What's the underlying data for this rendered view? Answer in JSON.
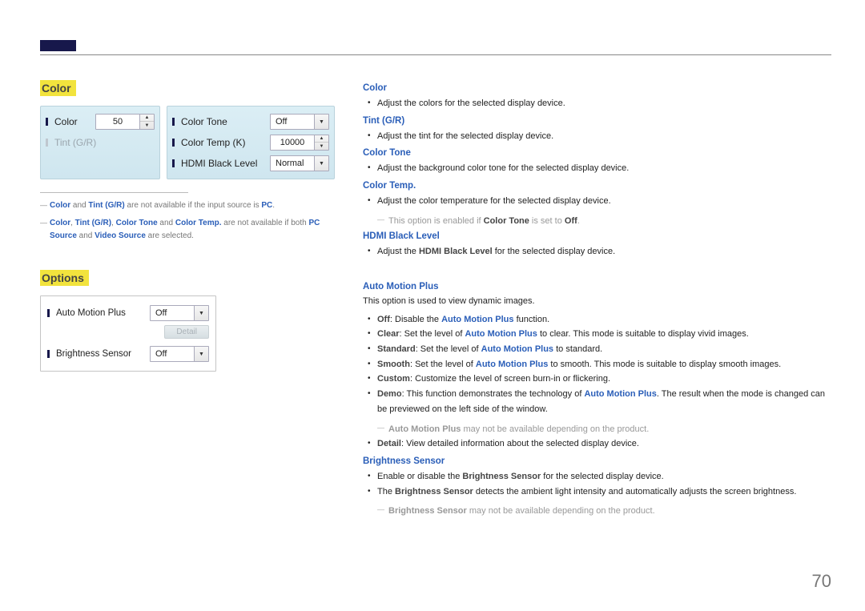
{
  "page_number": "70",
  "sections": {
    "color": {
      "title": "Color"
    },
    "options": {
      "title": "Options"
    }
  },
  "color_panel": {
    "left": {
      "color": {
        "label": "Color",
        "value": "50"
      },
      "tint": {
        "label": "Tint (G/R)"
      }
    },
    "right": {
      "color_tone": {
        "label": "Color Tone",
        "value": "Off"
      },
      "color_temp_k": {
        "label": "Color Temp (K)",
        "value": "10000"
      },
      "hdmi_black": {
        "label": "HDMI Black Level",
        "value": "Normal"
      }
    }
  },
  "color_footnotes": {
    "n1": {
      "b1": "Color",
      "t1": " and ",
      "b2": "Tint (G/R)",
      "t2": " are not available if the input source is ",
      "b3": "PC",
      "t3": "."
    },
    "n2": {
      "b1": "Color",
      "t1": ", ",
      "b2": "Tint (G/R)",
      "t2": ", ",
      "b3": "Color Tone",
      "t3": " and ",
      "b4": "Color Temp.",
      "t4": " are not available if both ",
      "b5": "PC Source",
      "t5": " and ",
      "b6": "Video Source",
      "t6": " are selected."
    }
  },
  "options_panel": {
    "amp": {
      "label": "Auto Motion Plus",
      "value": "Off"
    },
    "detail": {
      "label": "Detail"
    },
    "brightness": {
      "label": "Brightness Sensor",
      "value": "Off"
    }
  },
  "right": {
    "color": {
      "head": "Color",
      "li1": "Adjust the colors for the selected display device."
    },
    "tint": {
      "head": "Tint (G/R)",
      "li1": "Adjust the tint for the selected display device."
    },
    "tone": {
      "head": "Color Tone",
      "li1": "Adjust the background color tone for the selected display device."
    },
    "temp": {
      "head": "Color Temp.",
      "li1": "Adjust the color temperature for the selected display device.",
      "note": {
        "t1": "This option is enabled if ",
        "b1": "Color Tone",
        "t2": " is set to ",
        "b2": "Off",
        "t3": "."
      }
    },
    "hdmi": {
      "head": "HDMI Black Level",
      "li1": {
        "t1": "Adjust the ",
        "b1": "HDMI Black Level",
        "t2": " for the selected display device."
      }
    },
    "amp": {
      "head": "Auto Motion Plus",
      "intro": "This option is used to view dynamic images.",
      "li_off": {
        "b": "Off",
        "t": ": Disable the ",
        "b2": "Auto Motion Plus",
        "t2": " function."
      },
      "li_clear": {
        "b": "Clear",
        "t": ": Set the level of ",
        "b2": "Auto Motion Plus",
        "t2": " to clear. This mode is suitable to display vivid images."
      },
      "li_std": {
        "b": "Standard",
        "t": ": Set the level of ",
        "b2": "Auto Motion Plus",
        "t2": " to standard."
      },
      "li_smooth": {
        "b": "Smooth",
        "t": ": Set the level of ",
        "b2": "Auto Motion Plus",
        "t2": " to smooth. This mode is suitable to display smooth images."
      },
      "li_custom": {
        "b": "Custom",
        "t": ": Customize the level of screen burn-in or flickering."
      },
      "li_demo": {
        "b": "Demo",
        "t": ": This function demonstrates the technology of ",
        "b2": "Auto Motion Plus",
        "t2": ". The result when the mode is changed can be previewed on the left side of the window."
      },
      "note": {
        "b1": "Auto Motion Plus",
        "t1": " may not be available depending on the product."
      },
      "li_detail": {
        "b": "Detail",
        "t": ": View detailed information about the selected display device."
      }
    },
    "bs": {
      "head": "Brightness Sensor",
      "li1": {
        "t1": "Enable or disable the ",
        "b1": "Brightness Sensor",
        "t2": " for the selected display device."
      },
      "li2": {
        "t1": "The ",
        "b1": "Brightness Sensor",
        "t2": " detects the ambient light intensity and automatically adjusts the screen brightness."
      },
      "note": {
        "b1": "Brightness Sensor",
        "t1": " may not be available depending on the product."
      }
    }
  }
}
